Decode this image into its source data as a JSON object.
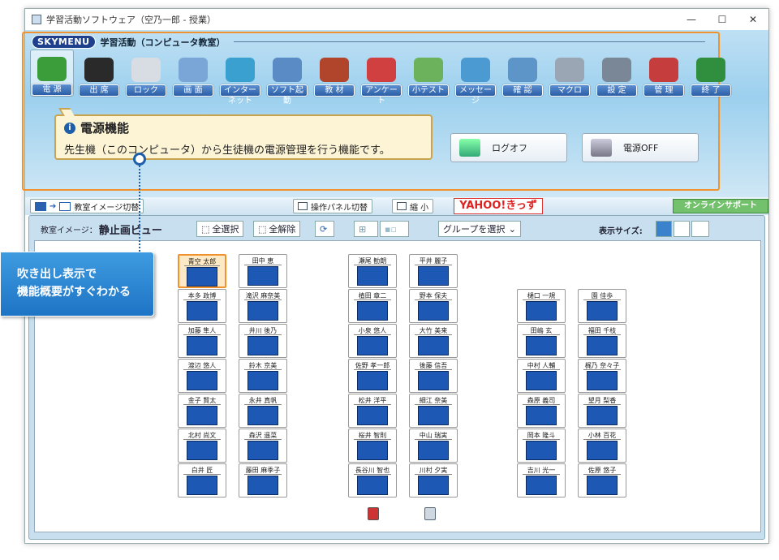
{
  "window": {
    "title": "学習活動ソフトウェア（空乃一郎 - 授業）",
    "min": "—",
    "max": "☐",
    "close": "✕"
  },
  "brand": {
    "logo": "SKYMENU",
    "app_title": "学習活動（コンピュータ教室）"
  },
  "tools": [
    {
      "label": "電 源",
      "icon": "power-icon",
      "color": "#3a9d3a",
      "active": true
    },
    {
      "label": "出 席",
      "icon": "attendance-book-icon",
      "color": "#2a2a2a"
    },
    {
      "label": "ロック",
      "icon": "lock-mouse-icon",
      "color": "#d8dde3"
    },
    {
      "label": "画 面",
      "icon": "monitor-icon",
      "color": "#79a6d6"
    },
    {
      "label": "インターネット",
      "icon": "internet-globe-icon",
      "color": "#3aa0d0"
    },
    {
      "label": "ソフト起動",
      "icon": "app-launch-icon",
      "color": "#5b8bc4"
    },
    {
      "label": "教 材",
      "icon": "teaching-materials-icon",
      "color": "#b0452b"
    },
    {
      "label": "アンケート",
      "icon": "survey-chart-icon",
      "color": "#d04040"
    },
    {
      "label": "小テスト",
      "icon": "quiz-icon",
      "color": "#6cb25c"
    },
    {
      "label": "メッセージ",
      "icon": "message-icon",
      "color": "#4b9ad2"
    },
    {
      "label": "確 認",
      "icon": "check-magnifier-icon",
      "color": "#5d95c8"
    },
    {
      "label": "マクロ",
      "icon": "macro-at-icon",
      "color": "#9aa6b4"
    },
    {
      "label": "設 定",
      "icon": "settings-gear-icon",
      "color": "#7a8796"
    },
    {
      "label": "管 理",
      "icon": "manage-tools-icon",
      "color": "#c63d3d"
    },
    {
      "label": "終 了",
      "icon": "exit-door-icon",
      "color": "#2f8f3e"
    }
  ],
  "bubble": {
    "title": "電源機能",
    "body": "先生機（このコンピュータ）から生徒機の電源管理を行う機能です。"
  },
  "panel_buttons": {
    "logoff": "ログオフ",
    "power_off": "電源OFF"
  },
  "toolbar": {
    "classroom_image_toggle": "教室イメージ切替",
    "panel_toggle": "操作パネル切替",
    "shrink": "縮 小",
    "yahoo": "YAHOO!きっず",
    "online_support": "オンラインサポート"
  },
  "classroom": {
    "label": "教室イメージ：",
    "mode": "静止画ビュー",
    "select_all": "全選択",
    "deselect_all": "全解除",
    "group_select": "グループを選択",
    "display_size": "表示サイズ:"
  },
  "callout": {
    "line1": "吹き出し表示で",
    "line2": "機能概要がすぐわかる"
  },
  "seats": [
    [
      "青空 太郎",
      "田中 恵",
      null,
      "瀬尾 勧朗",
      "平井 麗子",
      null,
      null,
      null
    ],
    [
      "本多 政博",
      "滝沢 麻奈美",
      null,
      "植田 章二",
      "野本 保夫",
      null,
      "樋口 一規",
      "園 佳歩"
    ],
    [
      "加藤 隼人",
      "井川 後乃",
      null,
      "小泉 悠人",
      "大竹 美来",
      null,
      "田嶋 玄",
      "福田 千枝"
    ],
    [
      "渡辺 悠人",
      "鈴木 京美",
      null,
      "佐野 孝一郎",
      "後藤 信吾",
      null,
      "中村 人輔",
      "梶乃 奈々子"
    ],
    [
      "金子 賢太",
      "永井 真帆",
      null,
      "松井 洋平",
      "細江 奈美",
      null,
      "森原 義司",
      "望月 梨香"
    ],
    [
      "北村 尚文",
      "森沢 遥菜",
      null,
      "桜井 智則",
      "中山 瑞実",
      null,
      "岡本 隆斗",
      "小林 百花"
    ],
    [
      "白井 匠",
      "藤田 麻季子",
      null,
      "長谷川 智也",
      "川村 夕実",
      null,
      "吉川 光一",
      "佐原 悠子"
    ]
  ]
}
